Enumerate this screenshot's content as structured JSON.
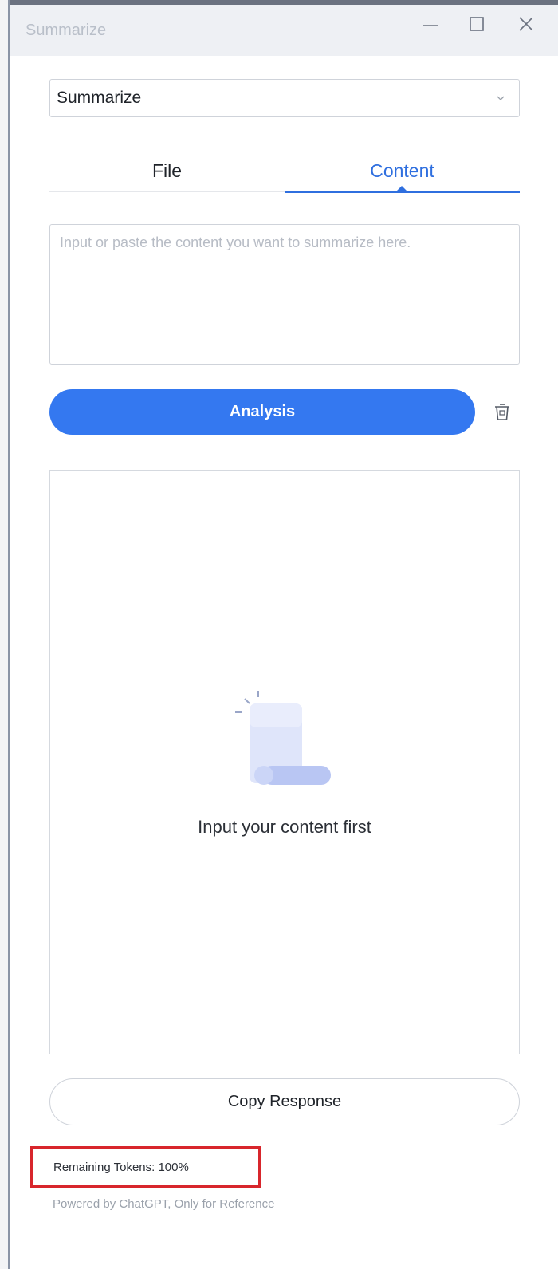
{
  "window": {
    "title": "Summarize",
    "controls": {
      "minimize_icon": "minimize-icon",
      "maximize_icon": "maximize-icon",
      "close_icon": "close-icon"
    }
  },
  "mode_select": {
    "selected": "Summarize",
    "chevron_icon": "chevron-down-icon"
  },
  "tabs": [
    {
      "label": "File",
      "active": false
    },
    {
      "label": "Content",
      "active": true
    }
  ],
  "content_input": {
    "value": "",
    "placeholder": "Input or paste the content you want to summarize here."
  },
  "actions": {
    "analysis_label": "Analysis",
    "delete_icon": "trash-icon"
  },
  "result": {
    "empty_icon": "document-icon",
    "empty_text": "Input your content first"
  },
  "copy_label": "Copy Response",
  "footer": {
    "tokens_text": "Remaining Tokens: 100%",
    "powered_text": "Powered by ChatGPT, Only for Reference"
  },
  "colors": {
    "accent": "#3478f0",
    "tab_active": "#2f6fdf",
    "highlight_border": "#d8262c"
  }
}
